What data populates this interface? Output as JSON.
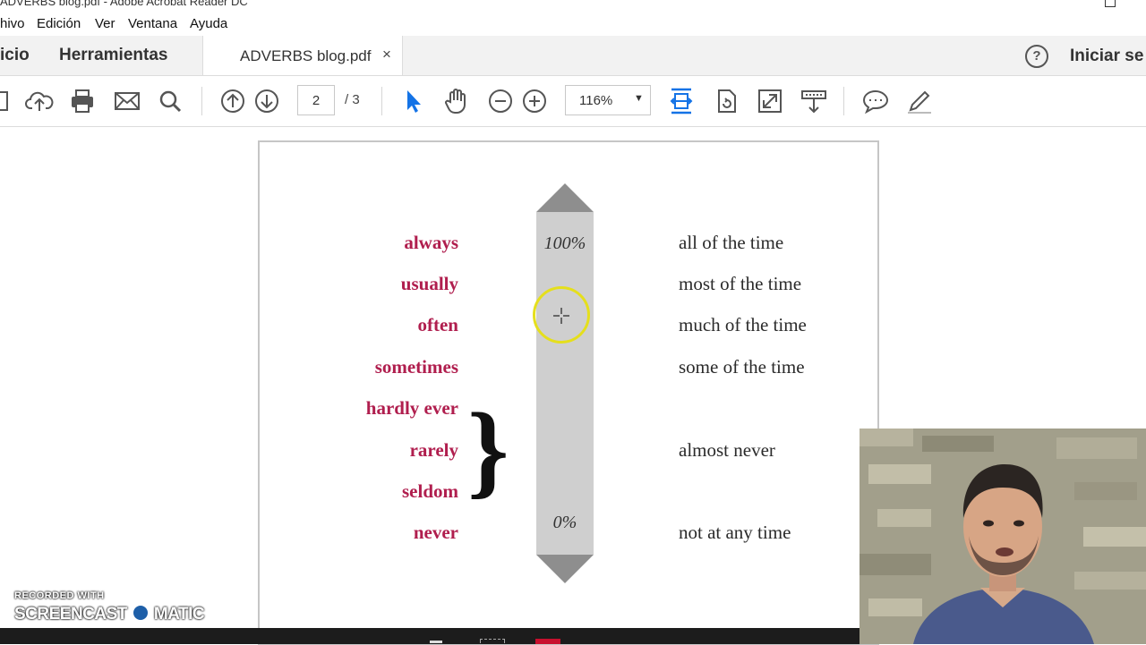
{
  "window": {
    "title": "ADVERBS blog.pdf - Adobe Acrobat Reader DC"
  },
  "menu": [
    "hivo",
    "Edición",
    "Ver",
    "Ventana",
    "Ayuda"
  ],
  "tabs": {
    "home": "icio",
    "tools": "Herramientas",
    "document": "ADVERBS blog.pdf",
    "close": "×",
    "help": "?",
    "signin": "Iniciar se"
  },
  "toolbar": {
    "page_current": "2",
    "page_total": "/ 3",
    "zoom": "116%",
    "zoom_caret": "▼"
  },
  "document": {
    "adverbs": [
      "always",
      "usually",
      "often",
      "sometimes",
      "hardly ever",
      "rarely",
      "seldom",
      "never"
    ],
    "meanings": [
      "all of the time",
      "most of the time",
      "much of the time",
      "some of the time",
      "almost never",
      "not at any time"
    ],
    "scale_top": "100%",
    "scale_bottom": "0%",
    "brace": "}"
  },
  "watermark": {
    "line1": "RECORDED WITH",
    "line2a": "SCREENCAST",
    "line2b": "MATIC"
  },
  "colors": {
    "adverb": "#b01e4e",
    "accent": "#1473e6",
    "bar": "#cfcfcf",
    "arrow": "#8e8e8e",
    "cursor_ring": "#e5df1c"
  }
}
